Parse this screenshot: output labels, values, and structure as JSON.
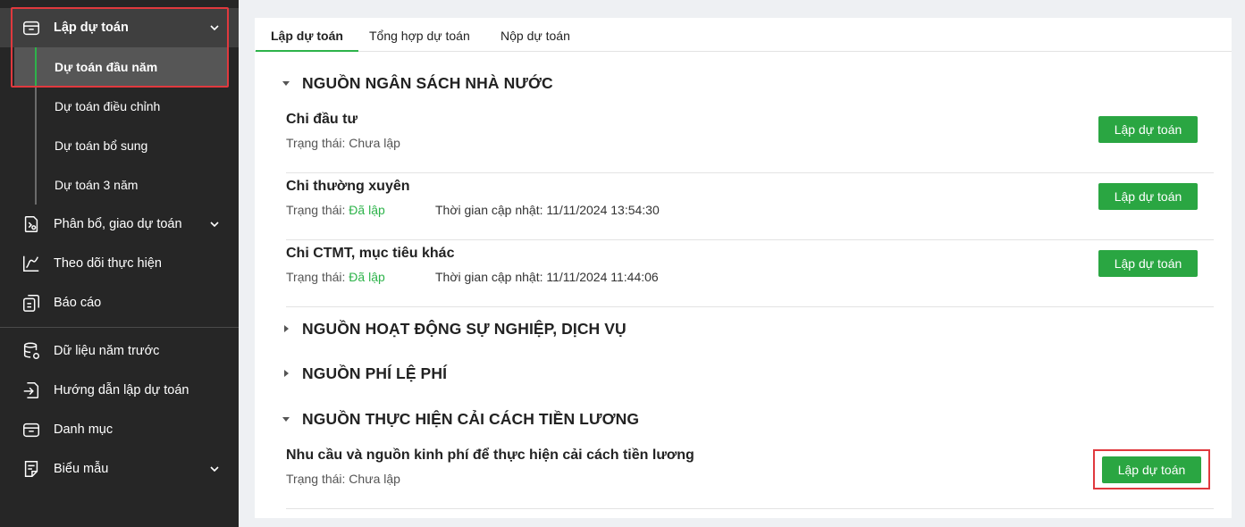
{
  "sidebar": {
    "items": [
      {
        "label": "Lập dự toán",
        "icon": "box-icon",
        "chevron": true
      },
      {
        "label": "Phân bổ, giao dự toán",
        "icon": "allocate-icon",
        "chevron": true
      },
      {
        "label": "Theo dõi thực hiện",
        "icon": "line-chart-icon",
        "chevron": false
      },
      {
        "label": "Báo cáo",
        "icon": "report-icon",
        "chevron": false
      },
      {
        "label": "Dữ liệu năm trước",
        "icon": "database-icon",
        "chevron": false
      },
      {
        "label": "Hướng dẫn lập dự toán",
        "icon": "guide-icon",
        "chevron": false
      },
      {
        "label": "Danh mục",
        "icon": "catalog-icon",
        "chevron": false
      },
      {
        "label": "Biểu mẫu",
        "icon": "form-icon",
        "chevron": true
      }
    ],
    "sub_items": [
      {
        "label": "Dự toán đầu năm",
        "selected": true
      },
      {
        "label": "Dự toán điều chỉnh",
        "selected": false
      },
      {
        "label": "Dự toán bổ sung",
        "selected": false
      },
      {
        "label": "Dự toán 3 năm",
        "selected": false
      }
    ]
  },
  "tabs": [
    {
      "label": "Lập dự toán",
      "active": true
    },
    {
      "label": "Tổng hợp dự toán",
      "active": false
    },
    {
      "label": "Nộp dự toán",
      "active": false
    }
  ],
  "sections": [
    {
      "title": "NGUỒN NGÂN SÁCH NHÀ NƯỚC",
      "expanded": true,
      "rows": [
        {
          "title": "Chi đầu tư",
          "status_label": "Trạng thái:",
          "status": "Chưa lập",
          "done": false,
          "time": "",
          "button": "Lập dự toán"
        },
        {
          "title": "Chi thường xuyên",
          "status_label": "Trạng thái:",
          "status": "Đã lập",
          "done": true,
          "time": "Thời gian cập nhật: 11/11/2024 13:54:30",
          "button": "Lập dự toán"
        },
        {
          "title": "Chi CTMT, mục tiêu khác",
          "status_label": "Trạng thái:",
          "status": "Đã lập",
          "done": true,
          "time": "Thời gian cập nhật: 11/11/2024 11:44:06",
          "button": "Lập dự toán"
        }
      ]
    },
    {
      "title": "NGUỒN HOẠT ĐỘNG SỰ NGHIỆP, DỊCH VỤ",
      "expanded": false,
      "rows": []
    },
    {
      "title": "NGUỒN PHÍ LỆ PHÍ",
      "expanded": false,
      "rows": []
    },
    {
      "title": "NGUỒN THỰC HIỆN CẢI CÁCH TIỀN LƯƠNG",
      "expanded": true,
      "rows": [
        {
          "title": "Nhu cầu và nguồn kinh phí để thực hiện cải cách tiền lương",
          "status_label": "Trạng thái:",
          "status": "Chưa lập",
          "done": false,
          "time": "",
          "button": "Lập dự toán"
        }
      ]
    }
  ],
  "colors": {
    "accent": "#2aa642",
    "highlight": "#e0393e",
    "sidebar_bg": "#262626"
  }
}
